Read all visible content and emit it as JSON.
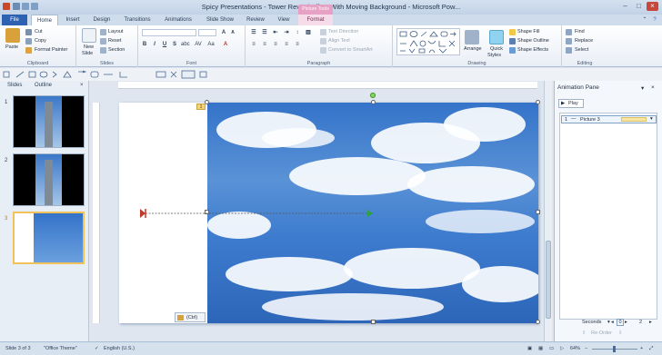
{
  "window": {
    "title": "Spicy Presentations - Tower Reveal Effect With Moving Background - Microsoft Pow...",
    "contextual_tab": "Picture Tools"
  },
  "tabs": [
    "File",
    "Home",
    "Insert",
    "Design",
    "Transitions",
    "Animations",
    "Slide Show",
    "Review",
    "View",
    "Format"
  ],
  "ribbon": {
    "clipboard": {
      "label": "Clipboard",
      "paste": "Paste",
      "cut": "Cut",
      "copy": "Copy",
      "format_painter": "Format Painter"
    },
    "slides": {
      "label": "Slides",
      "new_slide": "New",
      "new_slide2": "Slide",
      "layout": "Layout",
      "reset": "Reset",
      "section": "Section"
    },
    "font": {
      "label": "Font"
    },
    "paragraph": {
      "label": "Paragraph",
      "text_direction": "Text Direction",
      "align_text": "Align Text",
      "convert_smartart": "Convert to SmartArt"
    },
    "drawing": {
      "label": "Drawing",
      "arrange": "Arrange",
      "quick_styles": "Quick",
      "quick_styles2": "Styles",
      "shape_fill": "Shape Fill",
      "shape_outline": "Shape Outline",
      "shape_effects": "Shape Effects"
    },
    "editing": {
      "label": "Editing",
      "find": "Find",
      "replace": "Replace",
      "select": "Select"
    }
  },
  "panes": {
    "slides_tab": "Slides",
    "outline_tab": "Outline",
    "slide_numbers": [
      "1",
      "2",
      "3"
    ]
  },
  "slide": {
    "anim_tag": "1",
    "paste_options": "(Ctrl)"
  },
  "animation_pane": {
    "title": "Animation Pane",
    "play": "Play",
    "item_number": "1",
    "item_name": "Picture 3",
    "seconds": "Seconds",
    "timeline_start": "0",
    "timeline_mark": "2",
    "reorder": "Re-Order"
  },
  "status": {
    "slide": "Slide 3 of 3",
    "theme": "\"Office Theme\"",
    "language": "English (U.S.)",
    "zoom": "64%"
  },
  "colors": {
    "file_tab": "#2d62b2",
    "format_tab": "#e7a1c4",
    "sky": "#3e7ccf",
    "motion_start": "#c0392b",
    "motion_end": "#2ea043"
  }
}
